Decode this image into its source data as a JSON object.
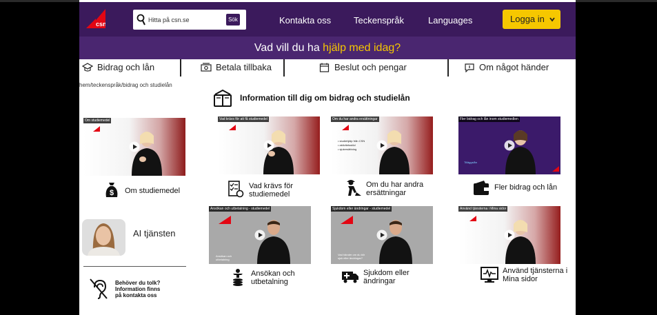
{
  "header": {
    "logo_text": "csn",
    "search": {
      "placeholder": "Hitta på csn.se",
      "button_label": "Sök"
    },
    "nav": [
      "Kontakta oss",
      "Teckenspråk",
      "Languages"
    ],
    "login_label": "Logga in"
  },
  "banner": {
    "text_plain": "Vad vill du ha ",
    "text_highlight": "hjälp med idag?"
  },
  "tabs": [
    {
      "label": "Bidrag och lån",
      "icon": "graduation-cap-icon"
    },
    {
      "label": "Betala tillbaka",
      "icon": "money-icon"
    },
    {
      "label": "Beslut och pengar",
      "icon": "calendar-icon"
    },
    {
      "label": "Om något händer",
      "icon": "chat-icon"
    }
  ],
  "breadcrumb": "hem/teckenspråk/bidrag och studielån",
  "section_title": "Information till dig om bidrag och studielån",
  "videos_row1": [
    {
      "thumb_label": "Om studiemedel",
      "caption": "Om studiemedel",
      "icon": "money-bag-icon"
    },
    {
      "thumb_label": "Vad krävs för att få studiemedel",
      "caption_line1": "Vad krävs för",
      "caption_line2": "studiemedel",
      "icon": "checklist-icon"
    },
    {
      "thumb_label": "Om du har andra ersättningar",
      "caption_line1": "Om du har andra",
      "caption_line2": "ersättningar",
      "icon": "construction-worker-icon",
      "bullets": [
        "studiehjälp från CSN",
        "aktivitetsstöd",
        "sjukersättning"
      ]
    },
    {
      "thumb_label": "Fler bidrag och lån inom studiemedlen",
      "caption": "Fler bidrag och lån",
      "icon": "wallet-icon",
      "overlay_text": "Tilläggslån"
    }
  ],
  "videos_row2": [
    {
      "thumb_label": "Ansökan och utbetalning - studiemedel",
      "caption_line1": "Ansökan och",
      "caption_line2": "utbetalning",
      "icon": "coins-person-icon",
      "overlay_text": "Ansökan och utbetalning"
    },
    {
      "thumb_label": "Sjukdom eller ändringar - studiemedel",
      "caption_line1": "Sjukdom eller",
      "caption_line2": "ändringar",
      "icon": "ambulance-icon",
      "overlay_text": "Vad händer om du blir sjuk eller ändringar?"
    },
    {
      "thumb_label": "Använd tjänsterna i Mina sidor",
      "caption_line1": "Använd tjänsterna i",
      "caption_line2": "Mina sidor",
      "icon": "monitor-pulse-icon"
    }
  ],
  "ai": {
    "label": "AI tjänsten"
  },
  "tolk": {
    "line1": "Behöver du tolk?",
    "line2": "Information finns",
    "line3": "på kontakta oss"
  },
  "colors": {
    "header": "#3b1a5c",
    "banner": "#4a2670",
    "accent": "#f6c700",
    "csn_red": "#e30613"
  }
}
